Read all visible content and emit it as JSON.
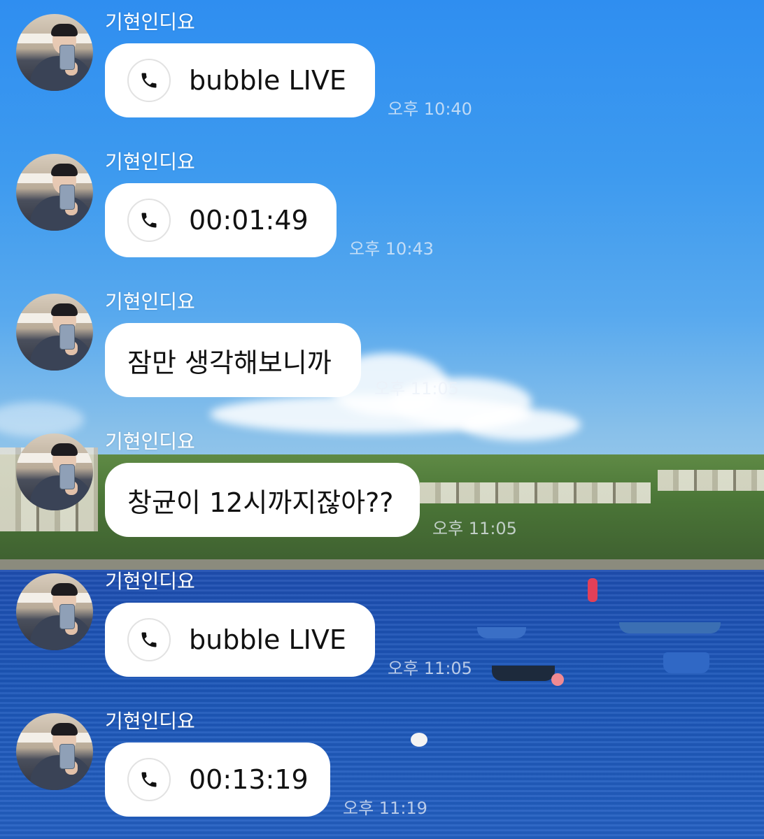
{
  "sender": "기현인디요",
  "icons": {
    "call": "phone-icon",
    "avatar": "avatar"
  },
  "messages": [
    {
      "type": "call",
      "text": "bubble LIVE",
      "time": "오후 10:40"
    },
    {
      "type": "call",
      "text": "00:01:49",
      "time": "오후 10:43"
    },
    {
      "type": "text",
      "text": "잠만 생각해보니까",
      "time": "오후 11:05"
    },
    {
      "type": "text",
      "text": "창균이 12시까지잖아??",
      "time": "오후 11:05"
    },
    {
      "type": "call",
      "text": "bubble LIVE",
      "time": "오후 11:05"
    },
    {
      "type": "call",
      "text": "00:13:19",
      "time": "오후 11:19"
    }
  ]
}
